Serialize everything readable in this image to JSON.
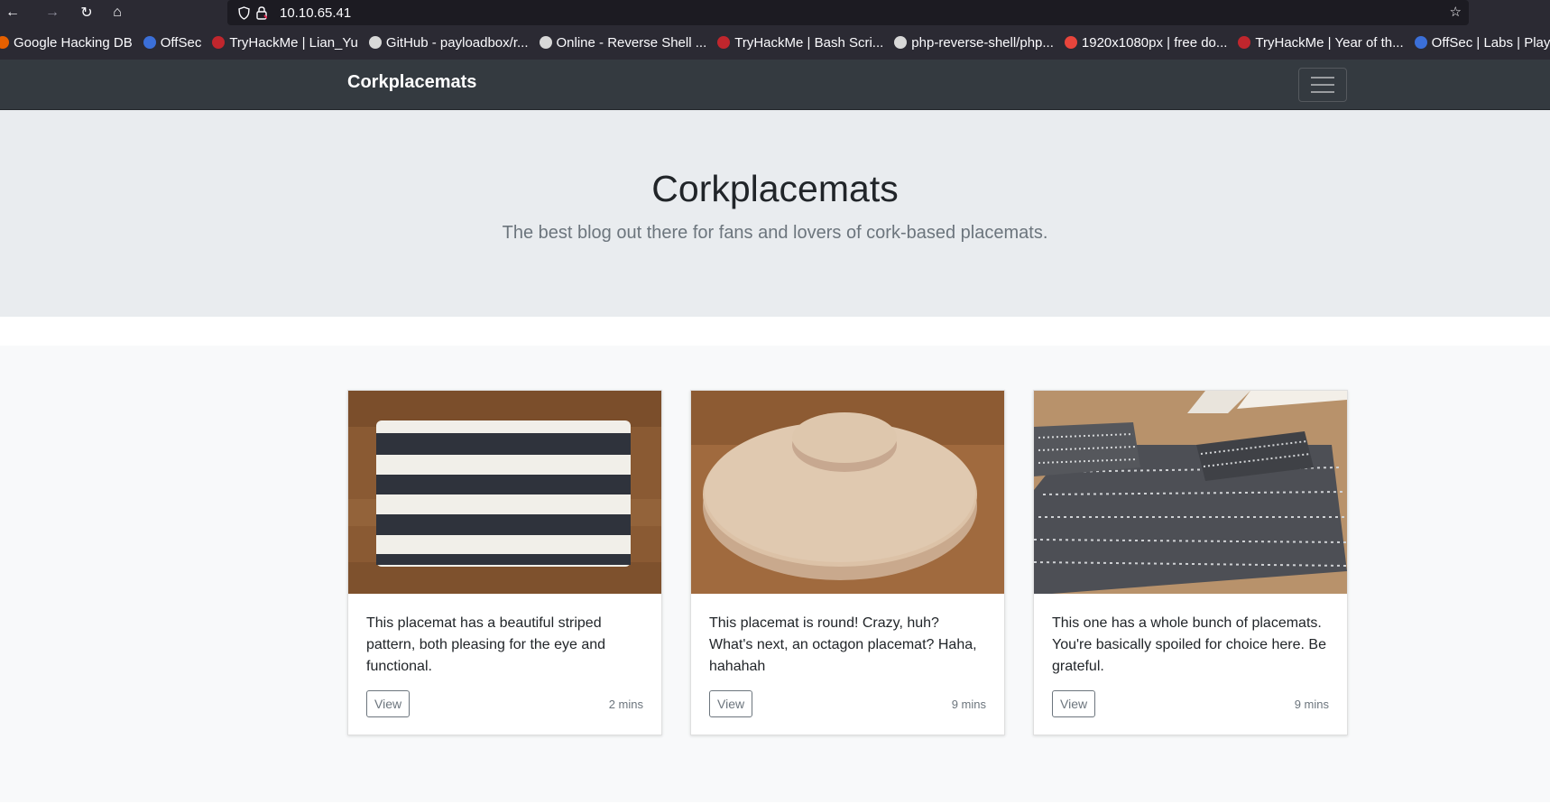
{
  "browser": {
    "url": "10.10.65.41",
    "bookmarks": [
      {
        "label": "Google Hacking DB",
        "color": "#e66000"
      },
      {
        "label": "OffSec",
        "color": "#3b6fd8"
      },
      {
        "label": "TryHackMe | Lian_Yu",
        "color": "#c0262d"
      },
      {
        "label": "GitHub - payloadbox/r...",
        "color": "#d8d8d8"
      },
      {
        "label": "Online - Reverse Shell ...",
        "color": "#d8d8d8"
      },
      {
        "label": "TryHackMe | Bash Scri...",
        "color": "#c0262d"
      },
      {
        "label": "php-reverse-shell/php...",
        "color": "#d8d8d8"
      },
      {
        "label": "1920x1080px | free do...",
        "color": "#e8453c"
      },
      {
        "label": "TryHackMe | Year of th...",
        "color": "#c0262d"
      },
      {
        "label": "OffSec | Labs | Play",
        "color": "#3b6fd8"
      }
    ]
  },
  "navbar": {
    "brand": "Corkplacemats"
  },
  "hero": {
    "title": "Corkplacemats",
    "subtitle": "The best blog out there for fans and lovers of cork-based placemats."
  },
  "cards": [
    {
      "text": "This placemat has a beautiful striped pattern, both pleasing for the eye and functional.",
      "button": "View",
      "time": "2 mins"
    },
    {
      "text": "This placemat is round! Crazy, huh? What's next, an octagon placemat? Haha, hahahah",
      "button": "View",
      "time": "9 mins"
    },
    {
      "text": "This one has a whole bunch of placemats. You're basically spoiled for choice here. Be grateful.",
      "button": "View",
      "time": "9 mins"
    }
  ]
}
